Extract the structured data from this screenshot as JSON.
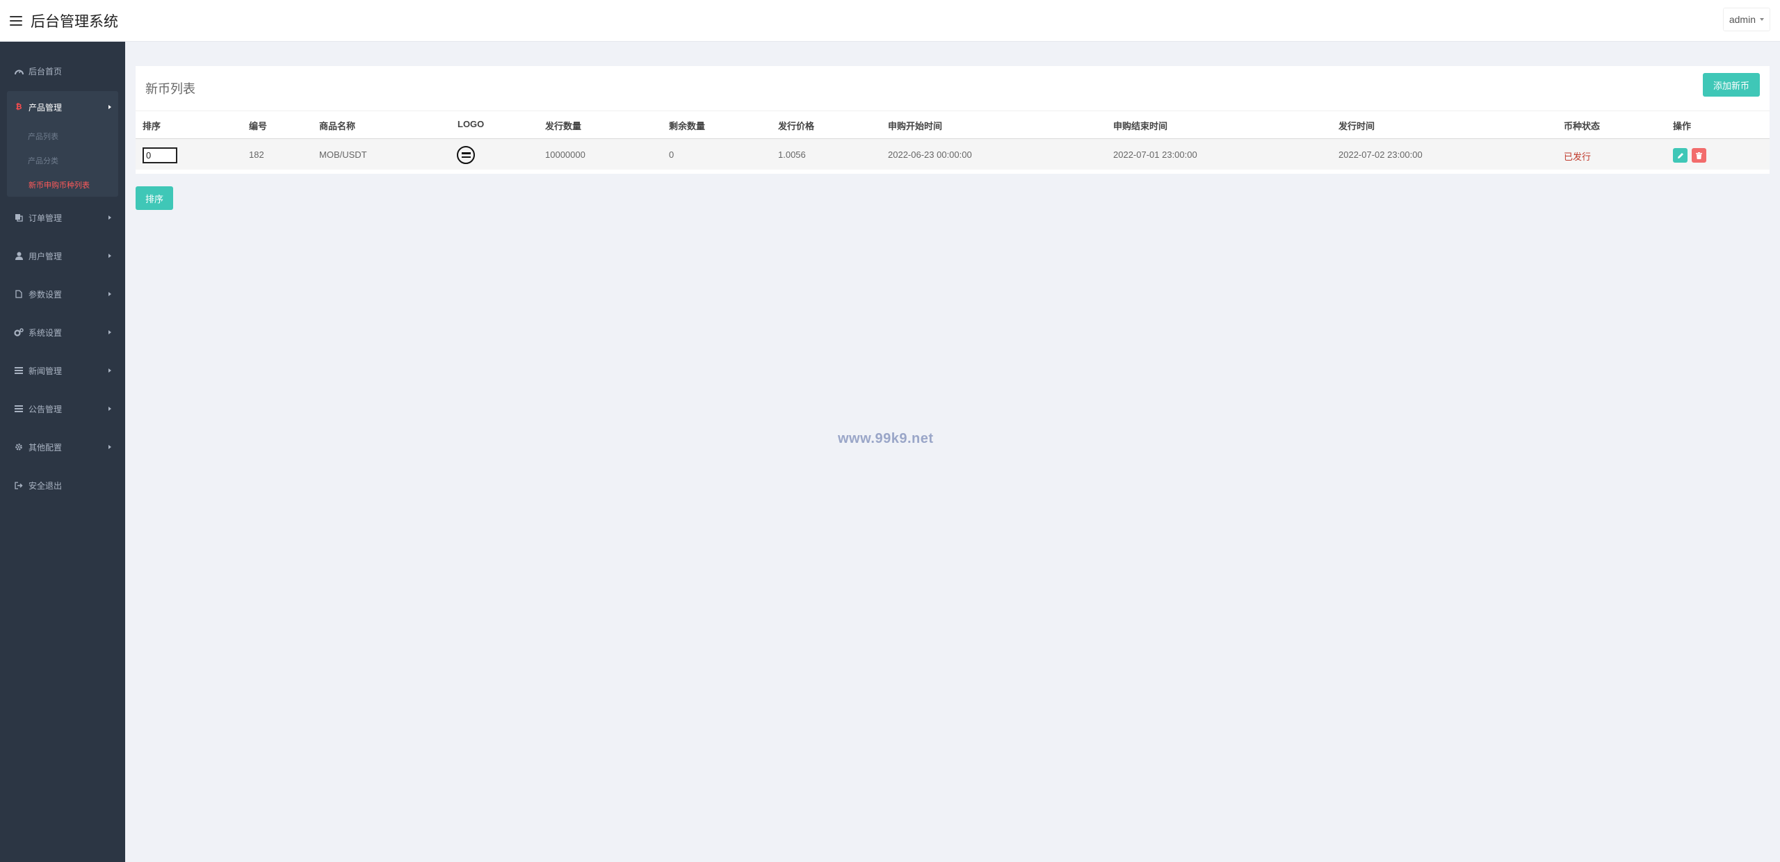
{
  "header": {
    "app_title": "后台管理系统",
    "user": "admin"
  },
  "sidebar": {
    "items": [
      {
        "label": "后台首页",
        "icon": "dashboard-icon"
      },
      {
        "label": "产品管理",
        "icon": "bitcoin-icon",
        "expanded": true
      },
      {
        "label": "订单管理",
        "icon": "copy-icon"
      },
      {
        "label": "用户管理",
        "icon": "user-icon"
      },
      {
        "label": "参数设置",
        "icon": "file-icon"
      },
      {
        "label": "系统设置",
        "icon": "gears-icon"
      },
      {
        "label": "新闻管理",
        "icon": "list-icon"
      },
      {
        "label": "公告管理",
        "icon": "list-icon"
      },
      {
        "label": "其他配置",
        "icon": "gear-icon"
      },
      {
        "label": "安全退出",
        "icon": "sign-out-icon"
      }
    ],
    "sub_items": [
      {
        "label": "产品列表",
        "active": false
      },
      {
        "label": "产品分类",
        "active": false
      },
      {
        "label": "新币申购币种列表",
        "active": true
      }
    ]
  },
  "panel": {
    "title": "新币列表",
    "add_button": "添加新币",
    "sort_button": "排序"
  },
  "table": {
    "columns": [
      "排序",
      "编号",
      "商品名称",
      "LOGO",
      "发行数量",
      "剩余数量",
      "发行价格",
      "申购开始时间",
      "申购结束时间",
      "发行时间",
      "币种状态",
      "操作"
    ],
    "rows": [
      {
        "sort": "0",
        "id": "182",
        "name": "MOB/USDT",
        "logo": "mob-coin-logo",
        "issue_qty": "10000000",
        "remaining_qty": "0",
        "price": "1.0056",
        "start_time": "2022-06-23 00:00:00",
        "end_time": "2022-07-01 23:00:00",
        "issue_time": "2022-07-02 23:00:00",
        "status": "已发行"
      }
    ]
  },
  "watermark": "www.99k9.net",
  "colors": {
    "accent": "#3fc7b7",
    "danger": "#f26c6c",
    "sidebar_bg": "#2c3644",
    "status_red": "#c0392b",
    "active_submenu": "#ff5a5a"
  }
}
